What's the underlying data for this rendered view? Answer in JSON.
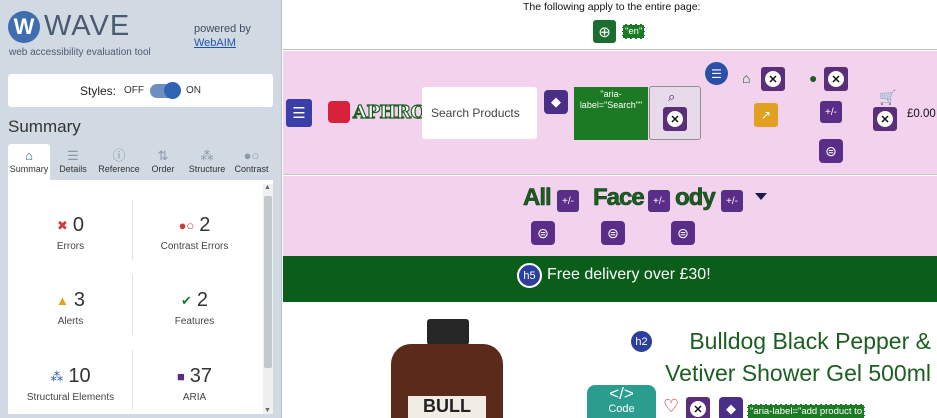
{
  "wave": {
    "logo_letter": "W",
    "logo_text": "WAVE",
    "tagline": "web accessibility evaluation tool",
    "powered_by": "powered by",
    "powered_link": "WebAIM",
    "styles_label": "Styles:",
    "styles_off": "OFF",
    "styles_on": "ON",
    "summary_title": "Summary",
    "tabs": [
      {
        "label": "Summary",
        "icon": "home-icon"
      },
      {
        "label": "Details",
        "icon": "list-icon"
      },
      {
        "label": "Reference",
        "icon": "info-icon"
      },
      {
        "label": "Order",
        "icon": "order-icon"
      },
      {
        "label": "Structure",
        "icon": "structure-icon"
      },
      {
        "label": "Contrast",
        "icon": "contrast-icon"
      }
    ],
    "active_tab": "Summary",
    "stats": {
      "errors": {
        "count": "0",
        "label": "Errors",
        "color": "#d23b3b"
      },
      "contrast_errors": {
        "count": "2",
        "label": "Contrast Errors",
        "color": "#d23b3b"
      },
      "alerts": {
        "count": "3",
        "label": "Alerts",
        "color": "#e1a021"
      },
      "features": {
        "count": "2",
        "label": "Features",
        "color": "#1b7a3a"
      },
      "structural": {
        "count": "10",
        "label": "Structural Elements",
        "color": "#2c5fb3"
      },
      "aria": {
        "count": "37",
        "label": "ARIA",
        "color": "#5a2e88"
      }
    }
  },
  "page": {
    "page_note": "The following apply to the entire page:",
    "lang_label": "\"en\"",
    "logo_text": "APHROS",
    "search_placeholder": "Search Products",
    "aria_search_label": "\"aria-label=\"Search\"\"",
    "price": "£0.00",
    "nav_items": [
      "All",
      "Face",
      "ody"
    ],
    "promo_badge": "h5",
    "promo_text": "Free delivery over £30!",
    "title_badge": "h2",
    "product_title": "Bulldog Black Pepper & Vetiver Shower Gel 500ml",
    "bottle_label": "BULL",
    "code_label": "Code",
    "code_glyph": "</>",
    "add_label": "\"aria-label=\"add product to"
  },
  "colors": {
    "wave_accent": "#2f64b5",
    "header_bg": "#f3d2ee",
    "promo_bg": "#0b5e1a",
    "title_color": "#1b5e20"
  }
}
